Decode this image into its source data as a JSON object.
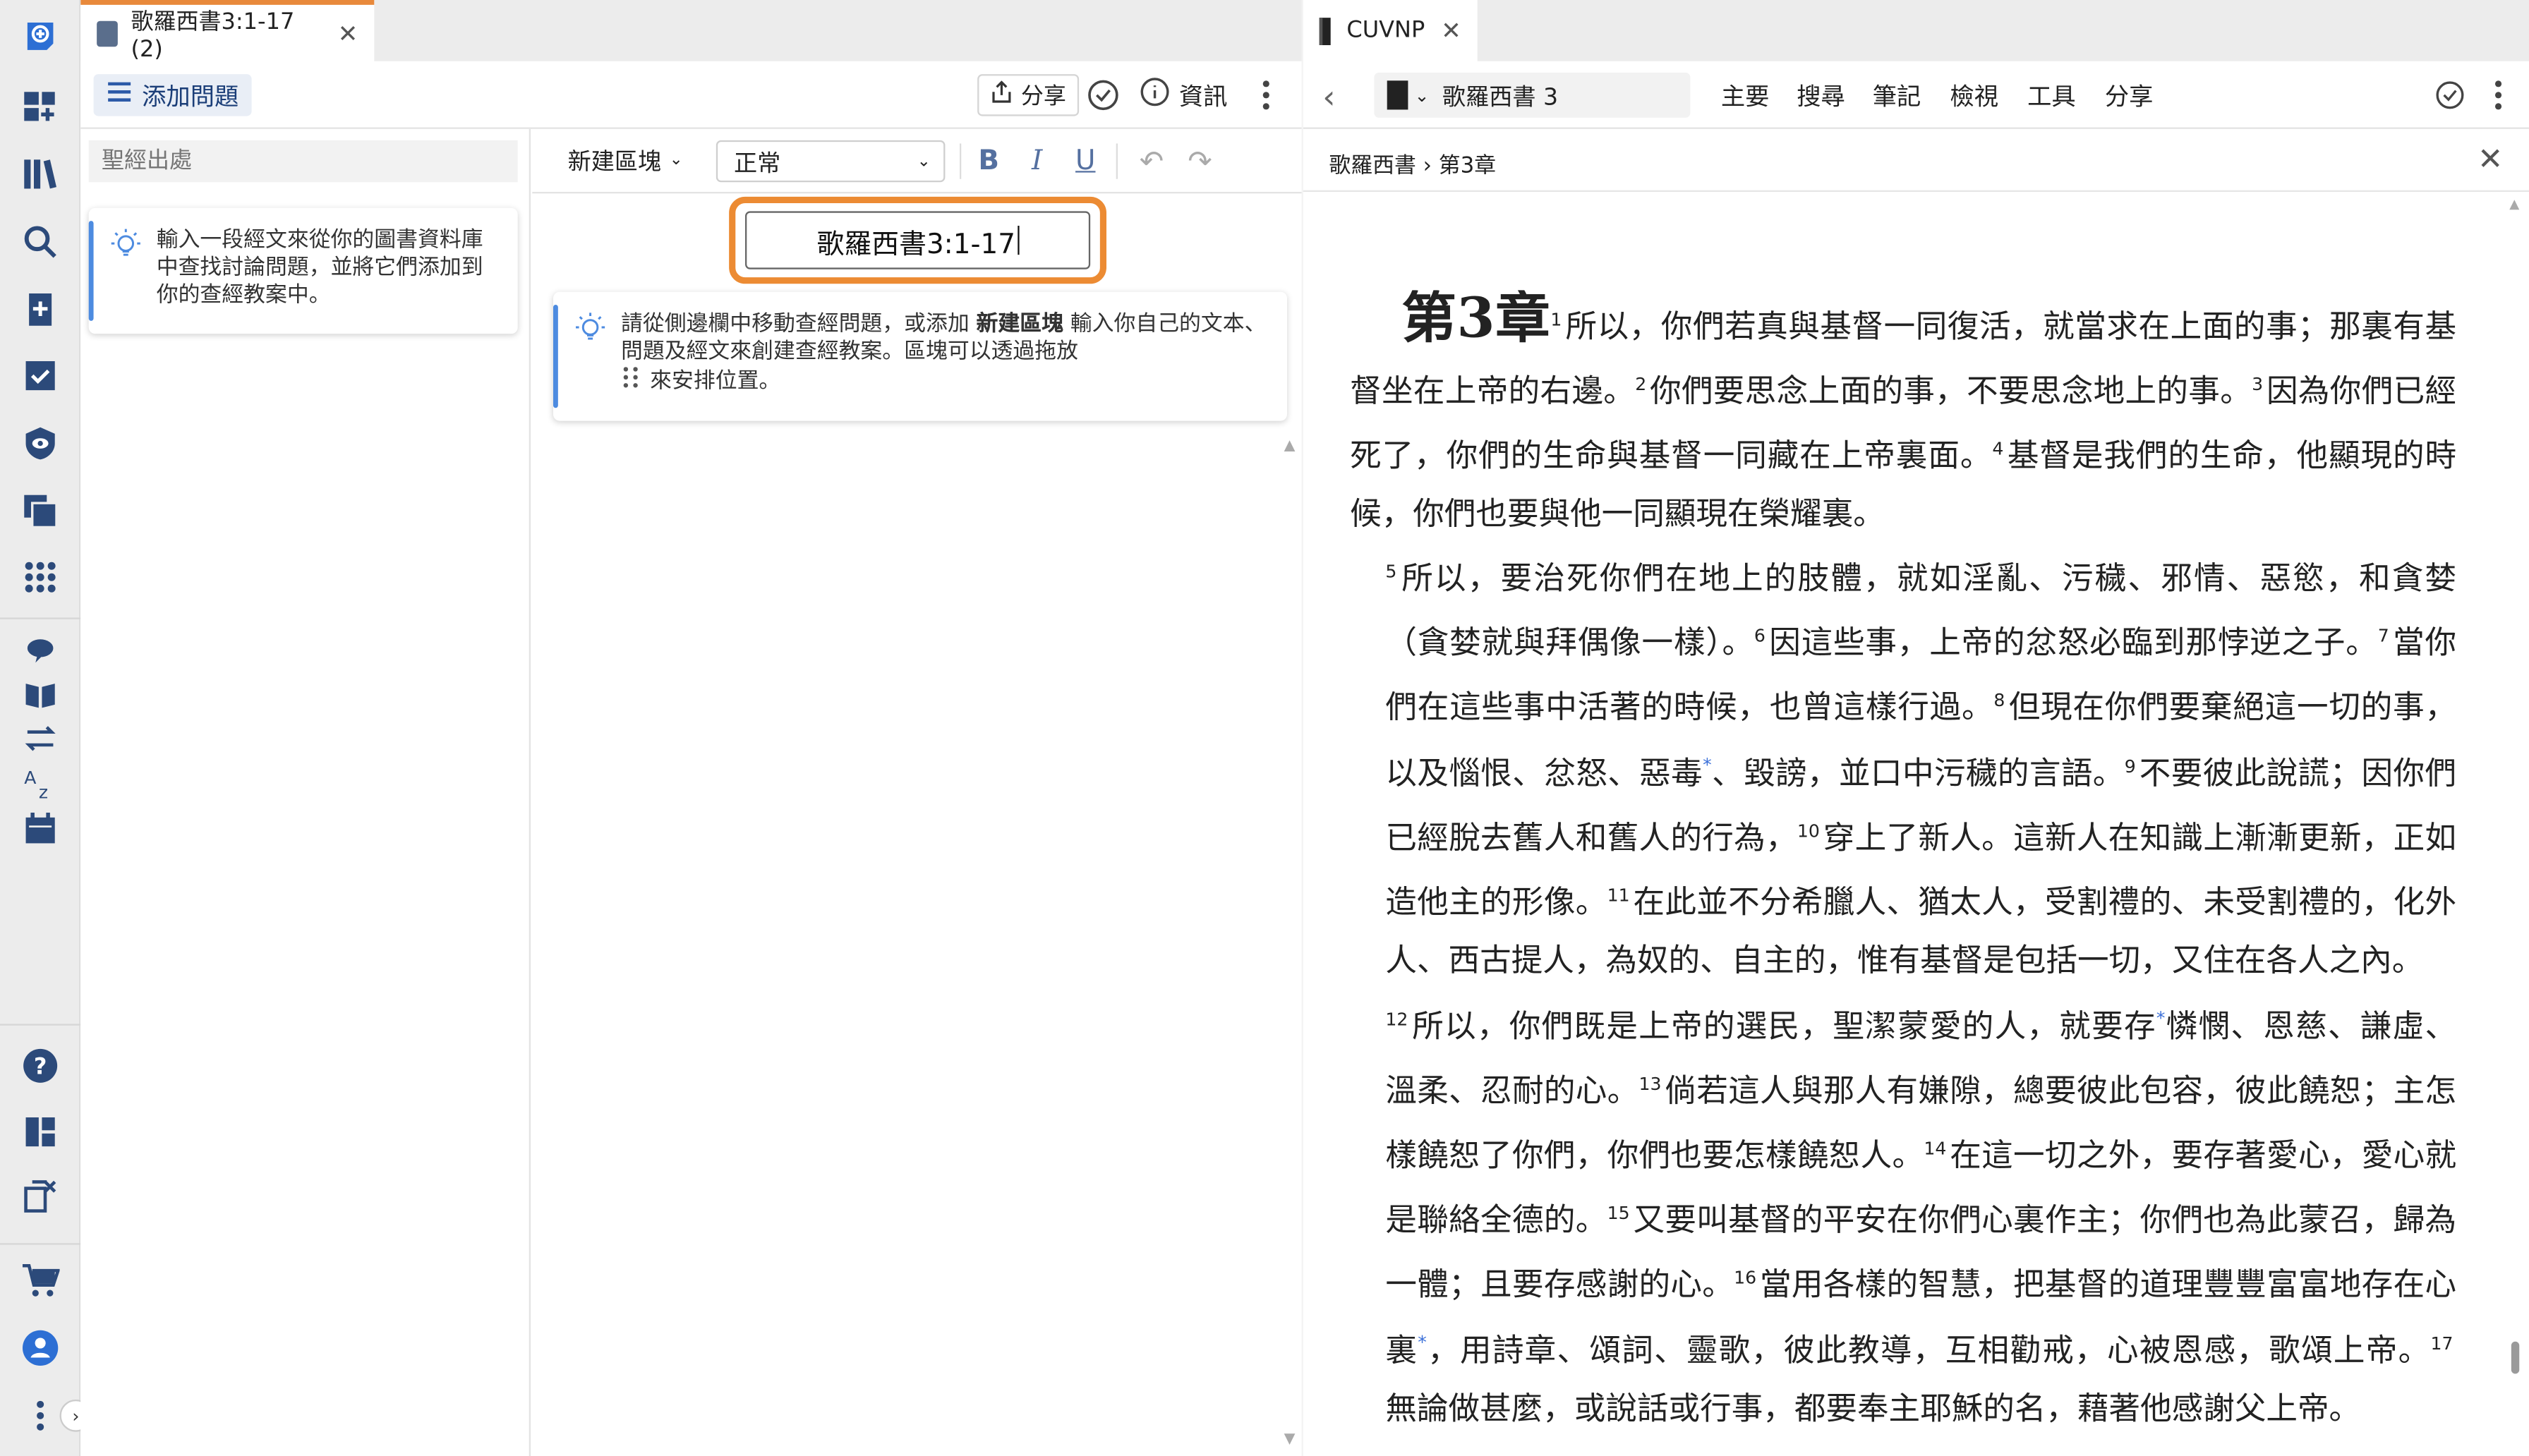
{
  "colors": {
    "accent_orange": "#e8893b",
    "link_blue": "#3a6fd8",
    "rail_blue": "#2d6fd4",
    "add_question_bg": "#e9eef6"
  },
  "rail": {
    "icons": [
      "add-note-icon",
      "dashboard-add-icon",
      "library-icon",
      "search-icon",
      "add-doc-icon",
      "checklist-icon",
      "eye-shield-icon",
      "copy-icon",
      "apps-icon",
      "comment-icon",
      "book-open-icon",
      "swap-icon",
      "sort-az-icon",
      "calendar-icon",
      "help-icon",
      "layout-icon",
      "close-panel-icon",
      "cart-icon",
      "account-icon",
      "more-icon"
    ]
  },
  "left_pane": {
    "tab_title": "歌羅西書3:1-17 (2)",
    "toolbar": {
      "add_question": "添加問題",
      "share": "分享",
      "info": "資訊"
    },
    "reference_placeholder": "聖經出處",
    "tip1": "輸入一段經文來從你的圖書資料庫中查找討論問題，並將它們添加到你的查經教案中。",
    "format": {
      "new_block": "新建區塊",
      "style": "正常",
      "bold": "B",
      "italic": "I",
      "underline": "U"
    },
    "title_value": "歌羅西書3:1-17",
    "tip2": {
      "part1": "請從側邊欄中移動查經問題，或添加 ",
      "bold": "新建區塊",
      "part2": " 輸入你自己的文本、問題及經文來創建查經教案。區塊可以透過拖放",
      "part3": "來安排位置。"
    }
  },
  "right_pane": {
    "tab_title": "CUVNP",
    "resource": "歌羅西書 3",
    "menu": [
      "主要",
      "搜尋",
      "筆記",
      "檢視",
      "工具",
      "分享"
    ],
    "breadcrumb": "歌羅西書 › 第3章",
    "chapter_label": "第3章",
    "p1": {
      "v1": "1",
      "t1": "所以，你們若真與基督一同復活，就當求在上面的事；那裏有基督坐在上帝的右邊。",
      "v2": "2",
      "t2": "你們要思念上面的事，不要思念地上的事。",
      "v3": "3",
      "t3": "因為你們已經死了，你們的生命與基督一同藏在上帝裏面。",
      "v4": "4",
      "t4": "基督是我們的生命，他顯現的時候，你們也要與他一同顯現在榮耀裏。"
    },
    "p2": {
      "v5": "5",
      "t5": "所以，要治死你們在地上的肢體，就如淫亂、污穢、邪情、惡慾，和貪婪（貪婪就與拜偶像一樣）。",
      "v6": "6",
      "t6": "因這些事，上帝的忿怒必臨到那悖逆之子。",
      "v7": "7",
      "t7": "當你們在這些事中活著的時候，也曾這樣行過。",
      "v8": "8",
      "t8a": "但現在你們要棄絕這一切的事，以及惱恨、忿怒、惡毒",
      "fn8": "*",
      "t8b": "、毀謗，並口中污穢的言語。",
      "v9": "9",
      "t9": "不要彼此說謊；因你們已經脫去舊人和舊人的行為，",
      "v10": "10",
      "t10": "穿上了新人。這新人在知識上漸漸更新，正如造他主的形像。",
      "v11": "11",
      "t11": "在此並不分希臘人、猶太人，受割禮的、未受割禮的，化外人、西古提人，為奴的、自主的，惟有基督是包括一切，又住在各人之內。"
    },
    "p3": {
      "v12": "12",
      "t12a": "所以，你們既是上帝的選民，聖潔蒙愛的人，就要存",
      "fn12": "*",
      "t12b": "憐憫、恩慈、謙虛、溫柔、忍耐的心。",
      "v13": "13",
      "t13": "倘若這人與那人有嫌隙，總要彼此包容，彼此饒恕；主怎樣饒恕了你們，你們也要怎樣饒恕人。",
      "v14": "14",
      "t14": "在這一切之外，要存著愛心，愛心就是聯絡全德的。",
      "v15": "15",
      "t15": "又要叫基督的平安在你們心裏作主；你們也為此蒙召，歸為一體；且要存感謝的心。",
      "v16": "16",
      "t16a": "當用各樣的智慧，把基督的道理豐豐富富地存在心裏",
      "fn16": "*",
      "t16b": "，用詩章、頌詞、靈歌，彼此教導，互相勸戒，心被恩感，歌頌上帝。",
      "v17": "17",
      "t17": "無論做甚麼，或說話或行事，都要奉主耶穌的名，藉著他感謝父上帝。"
    }
  }
}
